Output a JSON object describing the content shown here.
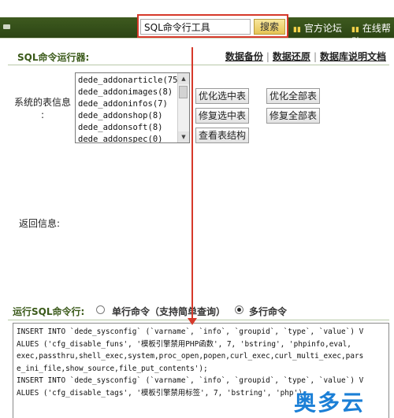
{
  "topbar": {
    "search_value": "SQL命令行工具",
    "search_button": "搜索",
    "nav_links": [
      "官方论坛",
      "在线帮助"
    ]
  },
  "section": {
    "title": "SQL命令运行器:",
    "links": [
      "数据备份",
      "数据还原",
      "数据库说明文档"
    ]
  },
  "tables": {
    "label": "系统的表信息\n:",
    "items": [
      "dede_addonarticle(75)",
      "dede_addonimages(8)",
      "dede_addoninfos(7)",
      "dede_addonshop(8)",
      "dede_addonsoft(8)",
      "dede_addonspec(0)"
    ]
  },
  "buttons": {
    "optimize_selected": "优化选中表",
    "optimize_all": "优化全部表",
    "repair_selected": "修复选中表",
    "repair_all": "修复全部表",
    "view_structure": "查看表结构"
  },
  "return_info_label": "返回信息:",
  "run": {
    "label": "运行SQL命令行:",
    "single": "单行命令（支持简单查询）",
    "multi": "多行命令",
    "selected": "multi"
  },
  "sql_text": "INSERT INTO `dede_sysconfig` (`varname`, `info`, `groupid`, `type`, `value`) V\nALUES ('cfg_disable_funs', '模板引擎禁用PHP函数', 7, 'bstring', 'phpinfo,eval,\nexec,passthru,shell_exec,system,proc_open,popen,curl_exec,curl_multi_exec,pars\ne_ini_file,show_source,file_put_contents');\nINSERT INTO `dede_sysconfig` (`varname`, `info`, `groupid`, `type`, `value`) V\nALUES ('cfg_disable_tags', '模板引擎禁用标签', 7, 'bstring', 'php');",
  "watermark": "奥多云",
  "colors": {
    "accent": "#3b5a1a",
    "highlight": "#d6392a",
    "watermark": "#1b7fd6"
  }
}
